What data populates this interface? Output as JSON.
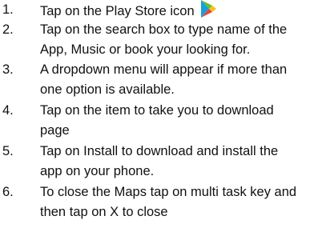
{
  "steps": [
    {
      "number": "1.",
      "lines": [
        "Tap on the Play Store icon"
      ],
      "icon": "play-store-icon"
    },
    {
      "number": "2.",
      "lines": [
        "Tap on the search box to type name of the",
        "App, Music or book your looking for."
      ]
    },
    {
      "number": "3.",
      "lines": [
        "A dropdown menu will appear if more than",
        "one option is available."
      ]
    },
    {
      "number": "4.",
      "lines": [
        "Tap on the item to take you to download",
        "page"
      ]
    },
    {
      "number": "5.",
      "lines": [
        "Tap on Install to download and install the",
        "app on your phone."
      ]
    },
    {
      "number": "6.",
      "lines": [
        "To close the Maps tap on multi task key and",
        "then tap on X to close"
      ]
    }
  ],
  "colors": {
    "text": "#111111",
    "icon_blue": "#1aa0d8",
    "icon_green": "#5fbf3a",
    "icon_yellow": "#f7c21c",
    "icon_red": "#e8453c"
  }
}
